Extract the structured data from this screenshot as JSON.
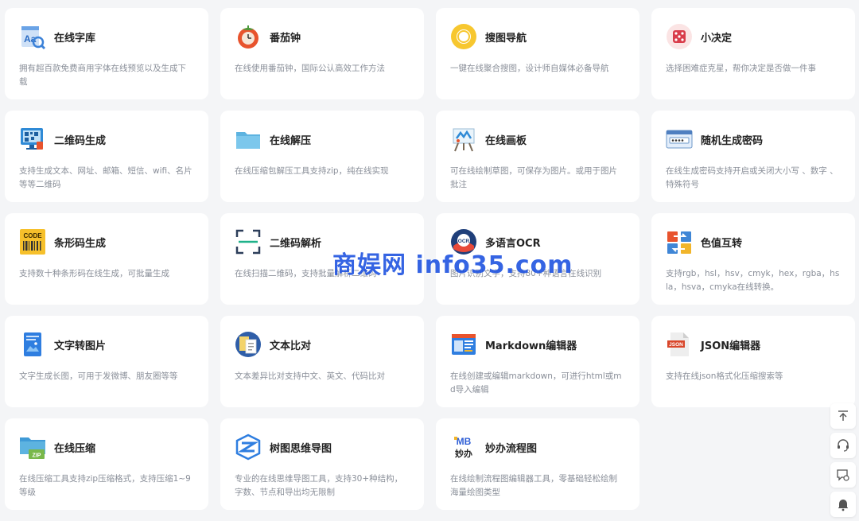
{
  "tools": [
    {
      "title": "在线字库",
      "desc": "拥有超百款免费商用字体在线预览以及生成下载",
      "icon": "font-library-icon"
    },
    {
      "title": "番茄钟",
      "desc": "在线使用番茄钟，国际公认高效工作方法",
      "icon": "tomato-clock-icon"
    },
    {
      "title": "搜图导航",
      "desc": "一键在线聚合搜图，设计师自媒体必备导航",
      "icon": "search-ring-icon"
    },
    {
      "title": "小决定",
      "desc": "选择困难症克星，帮你决定是否做一件事",
      "icon": "dice-icon"
    },
    {
      "title": "二维码生成",
      "desc": "支持生成文本、网址、邮箱、短信、wifi、名片等等二维码",
      "icon": "qrcode-monitor-icon"
    },
    {
      "title": "在线解压",
      "desc": "在线压缩包解压工具支持zip，纯在线实现",
      "icon": "folder-icon"
    },
    {
      "title": "在线画板",
      "desc": "可在线绘制草图，可保存为图片。或用于图片批注",
      "icon": "easel-icon"
    },
    {
      "title": "随机生成密码",
      "desc": "在线生成密码支持开启或关闭大小写 、数字 、特殊符号",
      "icon": "password-window-icon"
    },
    {
      "title": "条形码生成",
      "desc": "支持数十种条形码在线生成，可批量生成",
      "icon": "barcode-icon"
    },
    {
      "title": "二维码解析",
      "desc": "在线扫描二维码，支持批量解析二维码",
      "icon": "scan-frame-icon"
    },
    {
      "title": "多语言OCR",
      "desc": "图片识别文字，支持80+种语言在线识别",
      "icon": "ocr-globe-icon"
    },
    {
      "title": "色值互转",
      "desc": "支持rgb，hsl，hsv，cmyk，hex，rgba，hsla，hsva，cmyka在线转换。",
      "icon": "color-convert-icon"
    },
    {
      "title": "文字转图片",
      "desc": "文字生成长图，可用于发微博、朋友圈等等",
      "icon": "text-image-icon"
    },
    {
      "title": "文本比对",
      "desc": "文本差异比对支持中文、英文、代码比对",
      "icon": "text-compare-icon"
    },
    {
      "title": "Markdown编辑器",
      "desc": "在线创建或编辑markdown，可进行html或md导入编辑",
      "icon": "markdown-editor-icon"
    },
    {
      "title": "JSON编辑器",
      "desc": "支持在线json格式化压缩搜索等",
      "icon": "json-file-icon"
    },
    {
      "title": "在线压缩",
      "desc": "在线压缩工具支持zip压缩格式，支持压缩1~9等级",
      "icon": "zip-folder-icon"
    },
    {
      "title": "树图思维导图",
      "desc": "专业的在线思维导图工具，支持30+种结构，字数、节点和导出均无限制",
      "icon": "mindmap-icon"
    },
    {
      "title": "妙办流程图",
      "desc": "在线绘制流程图编辑器工具，零基础轻松绘制海量绘图类型",
      "icon": "miaoban-logo-icon"
    }
  ],
  "icon_text": {
    "font_library": "Aa",
    "barcode": "CODE",
    "ocr": "OCR",
    "json": "JSON",
    "zip": "ZIP",
    "miaoban_top": "MB",
    "miaoban_bottom": "妙办"
  },
  "watermark": "商娱网 info35.com",
  "side_buttons": [
    "back-to-top-icon",
    "customer-service-icon",
    "feedback-icon",
    "notification-bell-icon"
  ]
}
